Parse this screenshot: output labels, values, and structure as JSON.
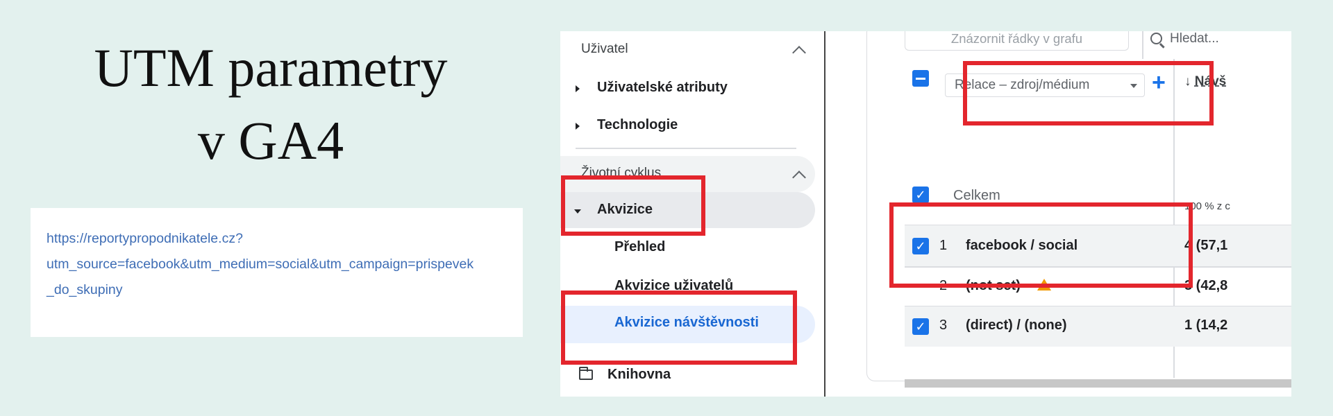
{
  "slide": {
    "title_line1": "UTM parametry",
    "title_line2": "v GA4"
  },
  "url_card": {
    "lines": [
      "https://reportypropodnikatele.cz?",
      "utm_source=facebook&utm_medium=social&utm_campaign=prispevek",
      "_do_skupiny"
    ]
  },
  "sidebar": {
    "section_user": "Uživatel",
    "user_items": [
      "Uživatelské atributy",
      "Technologie"
    ],
    "section_lifecycle": "Životní cyklus",
    "acquisition": "Akvizice",
    "acquisition_items": [
      "Přehled",
      "Akvizice uživatelů",
      "Akvizice návštěvnosti"
    ],
    "library": "Knihovna"
  },
  "table": {
    "plot_rows_button": "Znázornit řádky v grafu",
    "search_placeholder": "Hledat...",
    "dimension": "Relace – zdroj/médium",
    "add_dimension": "+",
    "metric_header": "Návš",
    "total_label": "Celkem",
    "total_value": "100 % z c",
    "rows": [
      {
        "num": "1",
        "label": "facebook / social",
        "value": "4 (57,1"
      },
      {
        "num": "2",
        "label": "(not set)",
        "value": "3 (42,8"
      },
      {
        "num": "3",
        "label": "(direct) / (none)",
        "value": "1 (14,2"
      }
    ]
  },
  "colors": {
    "background": "#e3f1ee",
    "highlight": "#e3262d",
    "checkbox": "#1a73e8",
    "link": "#3e6db5"
  },
  "icons": {
    "checkbox": "check-icon",
    "warning": "warning-icon",
    "folder": "folder-icon",
    "search": "search-icon"
  }
}
